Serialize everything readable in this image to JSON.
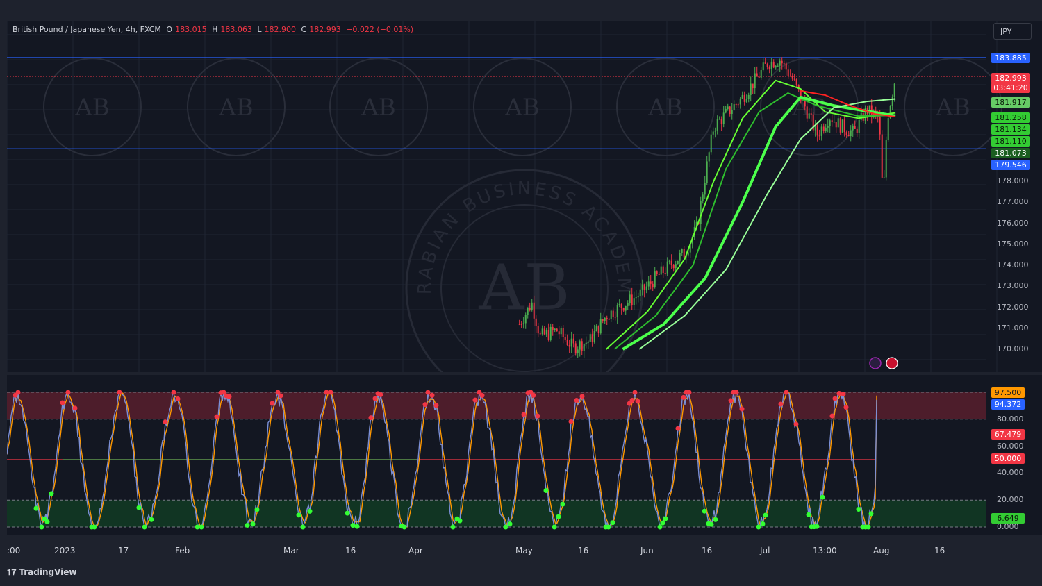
{
  "legend": {
    "symbol": "British Pound / Japanese Yen, 4h, FXCM",
    "o_label": "O",
    "o_value": "183.015",
    "h_label": "H",
    "h_value": "183.063",
    "l_label": "L",
    "l_value": "182.900",
    "c_label": "C",
    "c_value": "182.993",
    "change": "−0.022 (−0.01%)"
  },
  "currency_button": "JPY",
  "brand": "TradingView",
  "watermark": {
    "text": "ARABIAN BUSINESS ACADEMY",
    "initials": "AB"
  },
  "colors": {
    "up": "#4caf50",
    "down": "#f23645",
    "ema_fast": "#66ff33",
    "stoch_k": "#7b8fd6",
    "stoch_d": "#ff9800",
    "overbought_zone": "#5c1f2e",
    "oversold_zone": "#123d24",
    "support_line": "#2962ff"
  },
  "price_axis_ticks": [
    "178.000",
    "177.000",
    "176.000",
    "175.000",
    "174.000",
    "173.000",
    "172.000",
    "171.000",
    "170.000"
  ],
  "price_tags": [
    {
      "text": "183.885",
      "bg": "#2962ff",
      "fg": "#ffffff"
    },
    {
      "text": "182.993",
      "bg": "#f23645",
      "fg": "#ffffff"
    },
    {
      "text": "03:41:20",
      "bg": "#f23645",
      "fg": "#ffffff"
    },
    {
      "text": "181.917",
      "bg": "#66cc66",
      "fg": "#0a1a0a"
    },
    {
      "text": "181.258",
      "bg": "#33cc33",
      "fg": "#0a1a0a"
    },
    {
      "text": "181.134",
      "bg": "#33cc33",
      "fg": "#0a1a0a"
    },
    {
      "text": "181.110",
      "bg": "#33cc33",
      "fg": "#0a1a0a"
    },
    {
      "text": "181.073",
      "bg": "#1b5e20",
      "fg": "#ffffff"
    },
    {
      "text": "179.546",
      "bg": "#2962ff",
      "fg": "#ffffff"
    }
  ],
  "osc_axis_ticks": [
    "80.000",
    "60.000",
    "40.000",
    "20.000",
    "0.000"
  ],
  "osc_tags": [
    {
      "text": "97.500",
      "bg": "#ff9800",
      "fg": "#131722"
    },
    {
      "text": "94.372",
      "bg": "#2962ff",
      "fg": "#ffffff"
    },
    {
      "text": "67.479",
      "bg": "#f23645",
      "fg": "#ffffff"
    },
    {
      "text": "50.000",
      "bg": "#f23645",
      "fg": "#ffffff"
    },
    {
      "text": "6.649",
      "bg": "#33cc33",
      "fg": "#0a1a0a"
    }
  ],
  "time_axis": [
    ":00",
    "2023",
    "17",
    "Feb",
    "Mar",
    "16",
    "Apr",
    "May",
    "16",
    "Jun",
    "16",
    "Jul",
    "13:00",
    "Aug",
    "16"
  ],
  "chart_data": {
    "type": "candlestick",
    "symbol": "British Pound / Japanese Yen",
    "timeframe": "4h",
    "ylim": [
      170.0,
      184.5
    ],
    "horizontal_lines": [
      {
        "value": 183.885,
        "color": "#2962ff"
      },
      {
        "value": 179.546,
        "color": "#2962ff"
      },
      {
        "value": 182.993,
        "color": "#f23645",
        "style": "dotted"
      }
    ],
    "close_path": [
      {
        "date": "2023-05-01",
        "value": 171.2
      },
      {
        "date": "2023-05-04",
        "value": 172.2
      },
      {
        "date": "2023-05-06",
        "value": 170.6
      },
      {
        "date": "2023-05-10",
        "value": 170.9
      },
      {
        "date": "2023-05-14",
        "value": 170.1
      },
      {
        "date": "2023-05-18",
        "value": 170.4
      },
      {
        "date": "2023-05-22",
        "value": 171.6
      },
      {
        "date": "2023-05-26",
        "value": 172.1
      },
      {
        "date": "2023-05-30",
        "value": 172.6
      },
      {
        "date": "2023-06-03",
        "value": 173.4
      },
      {
        "date": "2023-06-07",
        "value": 174.1
      },
      {
        "date": "2023-06-10",
        "value": 174.6
      },
      {
        "date": "2023-06-13",
        "value": 175.8
      },
      {
        "date": "2023-06-15",
        "value": 178.3
      },
      {
        "date": "2023-06-17",
        "value": 180.6
      },
      {
        "date": "2023-06-20",
        "value": 181.2
      },
      {
        "date": "2023-06-24",
        "value": 182.0
      },
      {
        "date": "2023-06-27",
        "value": 182.8
      },
      {
        "date": "2023-06-30",
        "value": 183.6
      },
      {
        "date": "2023-07-03",
        "value": 183.8
      },
      {
        "date": "2023-07-06",
        "value": 182.9
      },
      {
        "date": "2023-07-09",
        "value": 181.6
      },
      {
        "date": "2023-07-12",
        "value": 180.2
      },
      {
        "date": "2023-07-15",
        "value": 181.1
      },
      {
        "date": "2023-07-18",
        "value": 180.6
      },
      {
        "date": "2023-07-21",
        "value": 180.3
      },
      {
        "date": "2023-07-24",
        "value": 181.4
      },
      {
        "date": "2023-07-27",
        "value": 181.0
      },
      {
        "date": "2023-07-28",
        "value": 177.0
      },
      {
        "date": "2023-07-29",
        "value": 181.0
      },
      {
        "date": "2023-07-31",
        "value": 182.99
      }
    ],
    "moving_averages": [
      {
        "color": "#66ff33",
        "points": [
          [
            "2023-05-22",
            170.0
          ],
          [
            "2023-06-01",
            171.8
          ],
          [
            "2023-06-10",
            174.3
          ],
          [
            "2023-06-17",
            178.0
          ],
          [
            "2023-06-24",
            181.0
          ],
          [
            "2023-07-02",
            182.8
          ],
          [
            "2023-07-08",
            182.4
          ],
          [
            "2023-07-14",
            181.3
          ],
          [
            "2023-07-22",
            181.0
          ],
          [
            "2023-07-31",
            181.258
          ]
        ]
      },
      {
        "color": "#2ebd2e",
        "points": [
          [
            "2023-05-24",
            170.0
          ],
          [
            "2023-06-03",
            171.6
          ],
          [
            "2023-06-12",
            174.0
          ],
          [
            "2023-06-20",
            178.6
          ],
          [
            "2023-06-28",
            181.3
          ],
          [
            "2023-07-05",
            182.2
          ],
          [
            "2023-07-12",
            181.6
          ],
          [
            "2023-07-22",
            181.1
          ],
          [
            "2023-07-31",
            181.134
          ]
        ]
      },
      {
        "color": "#4cff4c",
        "points": [
          [
            "2023-05-26",
            170.0
          ],
          [
            "2023-06-05",
            171.2
          ],
          [
            "2023-06-15",
            173.4
          ],
          [
            "2023-06-24",
            177.0
          ],
          [
            "2023-07-02",
            180.6
          ],
          [
            "2023-07-08",
            182.0
          ],
          [
            "2023-07-16",
            181.6
          ],
          [
            "2023-07-31",
            181.11
          ]
        ]
      },
      {
        "color": "#99ff99",
        "points": [
          [
            "2023-05-30",
            170.0
          ],
          [
            "2023-06-10",
            171.6
          ],
          [
            "2023-06-20",
            173.8
          ],
          [
            "2023-06-30",
            177.4
          ],
          [
            "2023-07-08",
            180.0
          ],
          [
            "2023-07-16",
            181.5
          ],
          [
            "2023-07-24",
            181.8
          ],
          [
            "2023-07-31",
            181.917
          ]
        ]
      },
      {
        "color": "#ff2222",
        "points": [
          [
            "2023-07-08",
            182.3
          ],
          [
            "2023-07-14",
            182.1
          ],
          [
            "2023-07-20",
            181.6
          ],
          [
            "2023-07-26",
            181.2
          ],
          [
            "2023-07-31",
            181.073
          ]
        ]
      }
    ],
    "oscillator": {
      "name": "Stochastic",
      "ylim": [
        0,
        100
      ],
      "levels": [
        20,
        50,
        80
      ],
      "last_k": 94.372,
      "last_d": 97.5,
      "signal": 67.479,
      "low": 6.649
    }
  }
}
